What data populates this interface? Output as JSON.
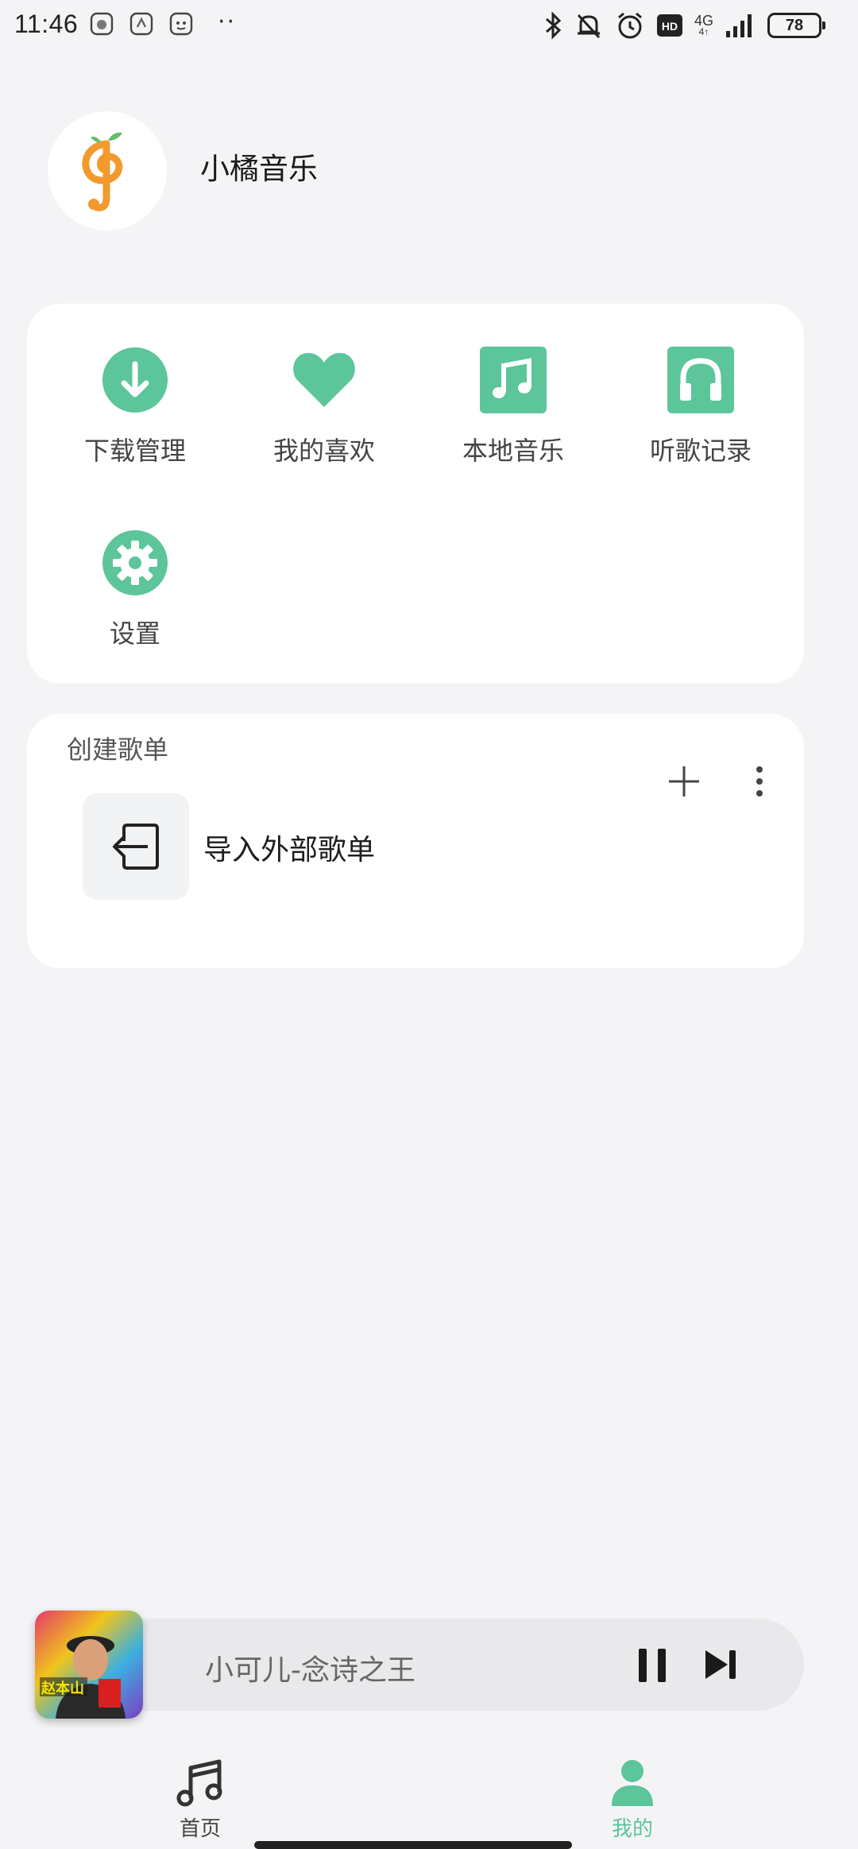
{
  "status_bar": {
    "time": "11:46",
    "network": "4G",
    "network_sub": "4↑",
    "battery": "78"
  },
  "app": {
    "name": "小橘音乐",
    "logo": "orange-music-note-logo"
  },
  "menu": {
    "items": [
      {
        "label": "下载管理",
        "icon": "download-icon"
      },
      {
        "label": "我的喜欢",
        "icon": "heart-icon"
      },
      {
        "label": "本地音乐",
        "icon": "music-note-icon"
      },
      {
        "label": "听歌记录",
        "icon": "headphones-icon"
      },
      {
        "label": "设置",
        "icon": "gear-icon"
      }
    ]
  },
  "playlists": {
    "section_title": "创建歌单",
    "import_label": "导入外部歌单"
  },
  "player": {
    "song": "小可儿-念诗之王",
    "cover_text": "赵本山"
  },
  "nav": {
    "home": "首页",
    "mine": "我的"
  },
  "colors": {
    "accent": "#5cc59a",
    "logo_orange": "#f29a2e",
    "background": "#f4f4f6"
  }
}
